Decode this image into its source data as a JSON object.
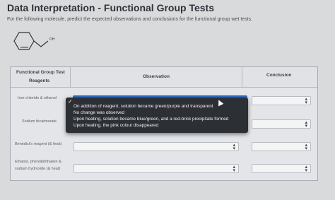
{
  "header": {
    "title": "Data Interpretation - Functional Group Tests",
    "instructions": "For the following molecule, predict the expected observations and conclusions for the functional group wet tests."
  },
  "molecule": {
    "substituent_label": "OH"
  },
  "table": {
    "headers": {
      "functional_group_line1": "Functional Group Test",
      "functional_group_line2": "Reagents",
      "observation": "Observation",
      "conclusion": "Conclusion"
    },
    "rows": [
      {
        "reagent": "Iron chloride & ethanol"
      },
      {
        "reagent": "Sodium bicarbonate"
      },
      {
        "reagent": "Benedict's reagent (& heat)"
      },
      {
        "reagent_line1": "Ethanol, phenolphthalein &",
        "reagent_line2": "sodium hydroxide (& heat)"
      }
    ]
  },
  "dropdown": {
    "check_glyph": "✓",
    "options": [
      "On addition of reagent, solution became green/purple and transparent",
      "No change was observed",
      "Upon heating, solution became blue/green, and a red-brick precipitate formed",
      "Upon heating, the pink colour disappeared"
    ]
  }
}
